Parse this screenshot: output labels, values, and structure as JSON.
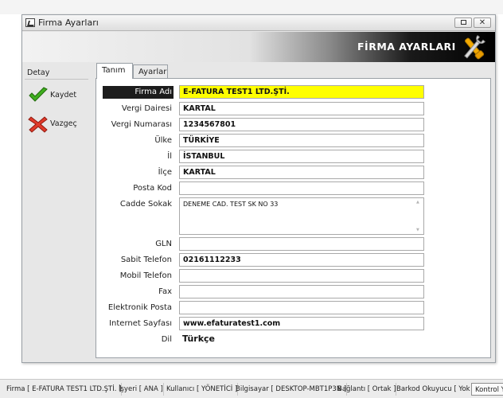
{
  "window": {
    "title": "Firma Ayarları"
  },
  "banner": {
    "title": "FİRMA AYARLARI",
    "icon": "tools-icon"
  },
  "sidebar": {
    "label": "Detay",
    "save_label": "Kaydet",
    "cancel_label": "Vazgeç"
  },
  "tabs": [
    {
      "label": "Tanım",
      "active": true
    },
    {
      "label": "Ayarlar",
      "active": false
    }
  ],
  "form": {
    "firma_adi": {
      "label": "Firma Adı",
      "value": "E-FATURA TEST1 LTD.ŞTİ."
    },
    "vergi_dairesi": {
      "label": "Vergi Dairesi",
      "value": "KARTAL"
    },
    "vergi_numarasi": {
      "label": "Vergi Numarası",
      "value": "1234567801"
    },
    "ulke": {
      "label": "Ülke",
      "value": "TÜRKİYE"
    },
    "il": {
      "label": "İl",
      "value": "İSTANBUL"
    },
    "ilce": {
      "label": "İlçe",
      "value": "KARTAL"
    },
    "posta_kod": {
      "label": "Posta Kod",
      "value": ""
    },
    "cadde_sokak": {
      "label": "Cadde Sokak",
      "value": "DENEME CAD. TEST SK NO 33"
    },
    "gln": {
      "label": "GLN",
      "value": ""
    },
    "sabit_telefon": {
      "label": "Sabit Telefon",
      "value": "02161112233"
    },
    "mobil_telefon": {
      "label": "Mobil Telefon",
      "value": ""
    },
    "fax": {
      "label": "Fax",
      "value": ""
    },
    "elektronik_posta": {
      "label": "Elektronik Posta",
      "value": ""
    },
    "internet_sayfasi": {
      "label": "Internet Sayfası",
      "value": "www.efaturatest1.com"
    },
    "dil": {
      "label": "Dil",
      "value": "Türkçe"
    }
  },
  "statusbar": {
    "firma": "Firma [ E-FATURA TEST1 LTD.ŞTİ. ]",
    "isyeri": "İşyeri [ ANA ]",
    "kullanici": "Kullanıcı [ YÖNETİCİ ]",
    "bilgisayar": "Bilgisayar [ DESKTOP-MBT1P3N ]",
    "baglanti": "Bağlantı [ Ortak ]",
    "barkod": "Barkod Okuyucu [ Yok ]",
    "kontrol": "Kontrol Ya"
  },
  "colors": {
    "highlight_label": "#1c1c1c",
    "required_field": "#ffff00"
  }
}
